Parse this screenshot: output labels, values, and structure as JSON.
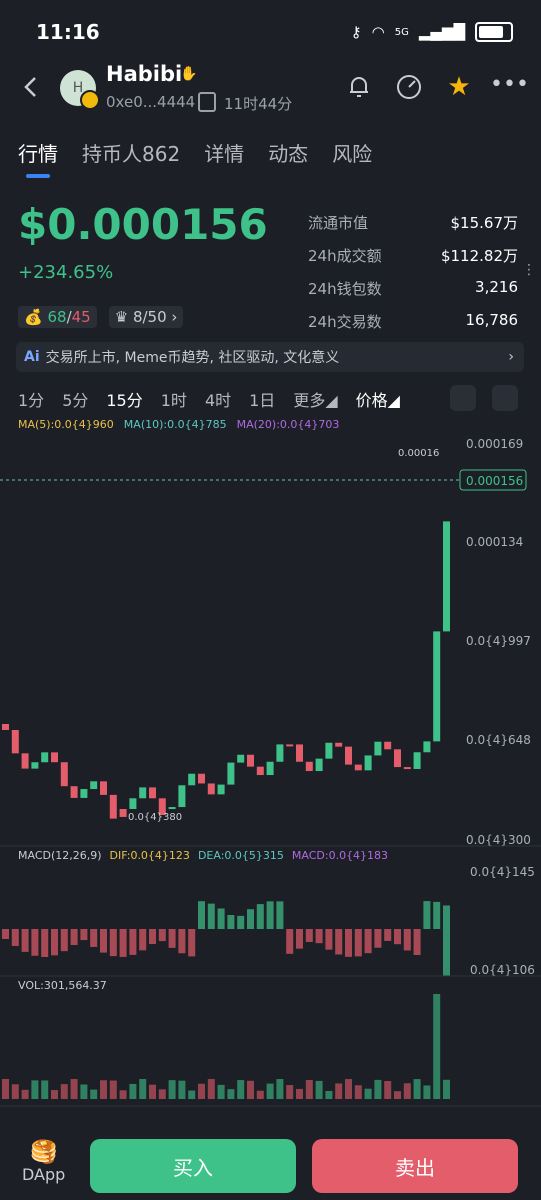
{
  "status": {
    "time": "11:16",
    "network": "5G"
  },
  "token": {
    "name": "Habibi",
    "avatar_letter": "H",
    "address": "0xe0...4444",
    "age": "11时44分"
  },
  "tabs": [
    {
      "label": "行情",
      "active": true
    },
    {
      "label": "持币人862",
      "active": false
    },
    {
      "label": "详情",
      "active": false
    },
    {
      "label": "动态",
      "active": false
    },
    {
      "label": "风险",
      "active": false
    }
  ],
  "price": {
    "value": "$0.000156",
    "change": "+234.65%"
  },
  "stats": [
    {
      "label": "流通市值",
      "value": "$15.67万"
    },
    {
      "label": "24h成交额",
      "value": "$112.82万"
    },
    {
      "label": "24h钱包数",
      "value": "3,216"
    },
    {
      "label": "24h交易数",
      "value": "16,786"
    }
  ],
  "badges": {
    "holders_a": "68",
    "holders_b": "45",
    "rank": "8/50"
  },
  "tagline": "交易所上市, Meme币趋势, 社区驱动, 文化意义",
  "intervals": [
    {
      "label": "1分",
      "active": false
    },
    {
      "label": "5分",
      "active": false
    },
    {
      "label": "15分",
      "active": true
    },
    {
      "label": "1时",
      "active": false
    },
    {
      "label": "4时",
      "active": false
    },
    {
      "label": "1日",
      "active": false
    },
    {
      "label": "更多",
      "active": false
    },
    {
      "label": "价格",
      "active": true
    }
  ],
  "ma": {
    "ma5": "MA(5):0.0{4}960",
    "ma10": "MA(10):0.0{4}785",
    "ma20": "MA(20):0.0{4}703"
  },
  "colors": {
    "up": "#3ec28a",
    "down": "#e35d6a",
    "ma5": "#e8c14a",
    "ma10": "#5cc8c0",
    "ma20": "#b06ae0"
  },
  "chart_data": {
    "type": "candlestick",
    "price_axis_labels": [
      "0.000169",
      "0.000134",
      "0.0{4}997",
      "0.0{4}648",
      "0.0{4}300"
    ],
    "current_price_label": "0.000156",
    "high_label": "0.00016",
    "low_label": "0.0{4}380",
    "ylim": [
      3e-05,
      0.000169
    ]
  },
  "macd": {
    "title": "MACD(12,26,9)",
    "dif": "DIF:0.0{4}123",
    "dea": "DEA:0.0{5}315",
    "macd": "MACD:0.0{4}183",
    "axis_top": "0.0{4}145",
    "axis_bottom": "0.0{4}106"
  },
  "volume": {
    "title": "VOL:301,564.37"
  },
  "bottom": {
    "dapp": "DApp",
    "buy": "买入",
    "sell": "卖出"
  }
}
